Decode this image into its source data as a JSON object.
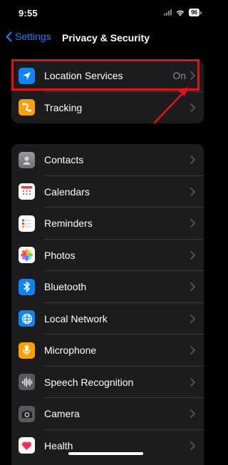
{
  "status": {
    "time": "9:55",
    "battery": "96"
  },
  "nav": {
    "back_label": "Settings",
    "title": "Privacy & Security"
  },
  "group1": [
    {
      "label": "Location Services",
      "value": "On",
      "icon": "location-arrow-icon",
      "color": "#0a84ff"
    },
    {
      "label": "Tracking",
      "icon": "tracking-icon",
      "color": "#ff9f0a"
    }
  ],
  "group2": [
    {
      "label": "Contacts",
      "icon": "contacts-icon",
      "color": "#8e8e93"
    },
    {
      "label": "Calendars",
      "icon": "calendar-icon",
      "color": "#ffffff"
    },
    {
      "label": "Reminders",
      "icon": "reminders-icon",
      "color": "#ffffff"
    },
    {
      "label": "Photos",
      "icon": "photos-icon",
      "color": "#ffffff"
    },
    {
      "label": "Bluetooth",
      "icon": "bluetooth-icon",
      "color": "#0a84ff"
    },
    {
      "label": "Local Network",
      "icon": "globe-icon",
      "color": "#0a84ff"
    },
    {
      "label": "Microphone",
      "icon": "microphone-icon",
      "color": "#ff9f0a"
    },
    {
      "label": "Speech Recognition",
      "icon": "waveform-icon",
      "color": "#5a5a5e"
    },
    {
      "label": "Camera",
      "icon": "camera-icon",
      "color": "#5a5a5e"
    },
    {
      "label": "Health",
      "icon": "heart-icon",
      "color": "#ffffff"
    }
  ],
  "annotation": {
    "color": "#e3131b"
  }
}
